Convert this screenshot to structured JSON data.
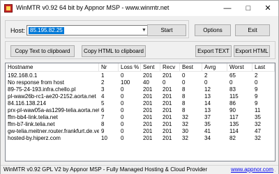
{
  "window": {
    "title": "WinMTR v0.92 64 bit by Appnor MSP - www.winmtr.net",
    "icon": "winmtr-app-icon",
    "controls": {
      "minimize": "—",
      "maximize": "□",
      "close": "✕"
    }
  },
  "host": {
    "label": "Host:",
    "value": "85.195.82.25",
    "dropdown_icon": "chevron-down-icon",
    "selection_color": "#0078d7"
  },
  "buttons": {
    "start": "Start",
    "options": "Options",
    "exit": "Exit",
    "copy_text": "Copy Text to clipboard",
    "copy_html": "Copy HTML to clipboard",
    "export_text": "Export TEXT",
    "export_html": "Export HTML"
  },
  "table": {
    "columns": [
      "Hostname",
      "Nr",
      "Loss %",
      "Sent",
      "Recv",
      "Best",
      "Avrg",
      "Worst",
      "Last"
    ],
    "rows": [
      [
        "192.168.0.1",
        "1",
        "0",
        "201",
        "201",
        "0",
        "2",
        "65",
        "2"
      ],
      [
        "No response from host",
        "2",
        "100",
        "40",
        "0",
        "0",
        "0",
        "0",
        "0"
      ],
      [
        "89-75-24-193.infra.chello.pl",
        "3",
        "0",
        "201",
        "201",
        "8",
        "12",
        "83",
        "9"
      ],
      [
        "pl-waw26b-rc1-ae20-2152.aorta.net",
        "4",
        "0",
        "201",
        "201",
        "8",
        "13",
        "115",
        "9"
      ],
      [
        "84.116.138.214",
        "5",
        "0",
        "201",
        "201",
        "8",
        "14",
        "86",
        "9"
      ],
      [
        "prx-pl-waw05a-as1299-telia.aorta.net",
        "6",
        "0",
        "201",
        "201",
        "8",
        "13",
        "90",
        "11"
      ],
      [
        "ffm-bb4-link.telia.net",
        "7",
        "0",
        "201",
        "201",
        "32",
        "37",
        "117",
        "35"
      ],
      [
        "ffm-b7-link.telia.net",
        "8",
        "0",
        "201",
        "201",
        "32",
        "35",
        "135",
        "32"
      ],
      [
        "gw-telia.meitner.router.frankfurt.de.ve...",
        "9",
        "0",
        "201",
        "201",
        "30",
        "41",
        "114",
        "47"
      ],
      [
        "hosted-by.hiperz.com",
        "10",
        "0",
        "201",
        "201",
        "32",
        "34",
        "82",
        "32"
      ]
    ]
  },
  "statusbar": {
    "text": "WinMTR v0.92 GPL V2 by Appnor MSP - Fully Managed Hosting & Cloud Provider",
    "link": "www.appnor.com",
    "grip_icon": "resize-grip-icon"
  }
}
